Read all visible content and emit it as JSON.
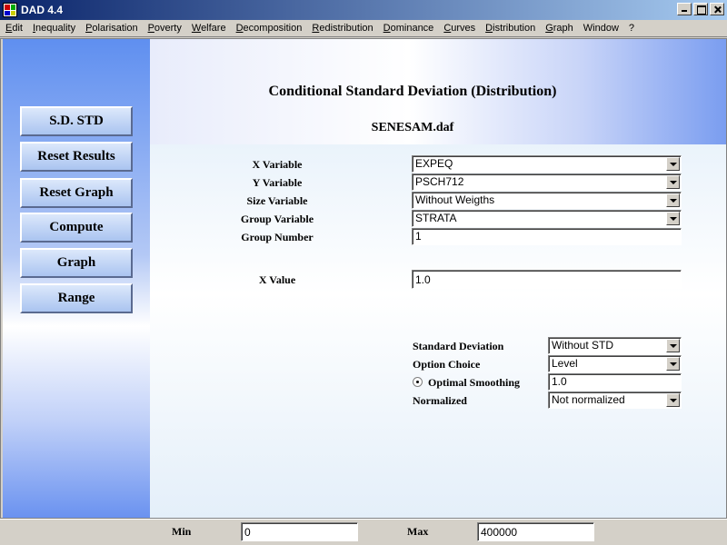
{
  "window": {
    "title": "DAD 4.4"
  },
  "menu": [
    {
      "pre": "",
      "u": "E",
      "post": "dit"
    },
    {
      "pre": "",
      "u": "I",
      "post": "nequality"
    },
    {
      "pre": "",
      "u": "P",
      "post": "olarisation"
    },
    {
      "pre": "",
      "u": "P",
      "post": "overty"
    },
    {
      "pre": "",
      "u": "W",
      "post": "elfare"
    },
    {
      "pre": "",
      "u": "D",
      "post": "ecomposition"
    },
    {
      "pre": "",
      "u": "R",
      "post": "edistribution"
    },
    {
      "pre": "",
      "u": "D",
      "post": "ominance"
    },
    {
      "pre": "",
      "u": "C",
      "post": "urves"
    },
    {
      "pre": "",
      "u": "D",
      "post": "istribution"
    },
    {
      "pre": "",
      "u": "G",
      "post": "raph"
    },
    {
      "pre": "Window",
      "u": "",
      "post": ""
    },
    {
      "pre": "?",
      "u": "",
      "post": ""
    }
  ],
  "sidebar": {
    "buttons": [
      "S.D. STD",
      "Reset Results",
      "Reset Graph",
      "Compute",
      "Graph",
      "Range"
    ]
  },
  "header": {
    "title": "Conditional Standard Deviation (Distribution)",
    "file": "SENESAM.daf"
  },
  "form": {
    "x_variable": {
      "label": "X Variable",
      "value": "EXPEQ"
    },
    "y_variable": {
      "label": "Y Variable",
      "value": "PSCH712"
    },
    "size_variable": {
      "label": "Size Variable",
      "value": "Without Weigths"
    },
    "group_variable": {
      "label": "Group Variable",
      "value": "STRATA"
    },
    "group_number": {
      "label": "Group Number",
      "value": "1"
    },
    "x_value": {
      "label": "X Value",
      "value": "1.0"
    }
  },
  "options": {
    "standard_deviation": {
      "label": "Standard Deviation",
      "value": "Without STD"
    },
    "option_choice": {
      "label": "Option Choice",
      "value": "Level"
    },
    "optimal_smoothing": {
      "label": "Optimal Smoothing",
      "value": "1.0",
      "selected": true
    },
    "normalized": {
      "label": "Normalized",
      "value": "Not normalized"
    }
  },
  "status": {
    "min_label": "Min",
    "min_value": "0",
    "max_label": "Max",
    "max_value": "400000"
  }
}
